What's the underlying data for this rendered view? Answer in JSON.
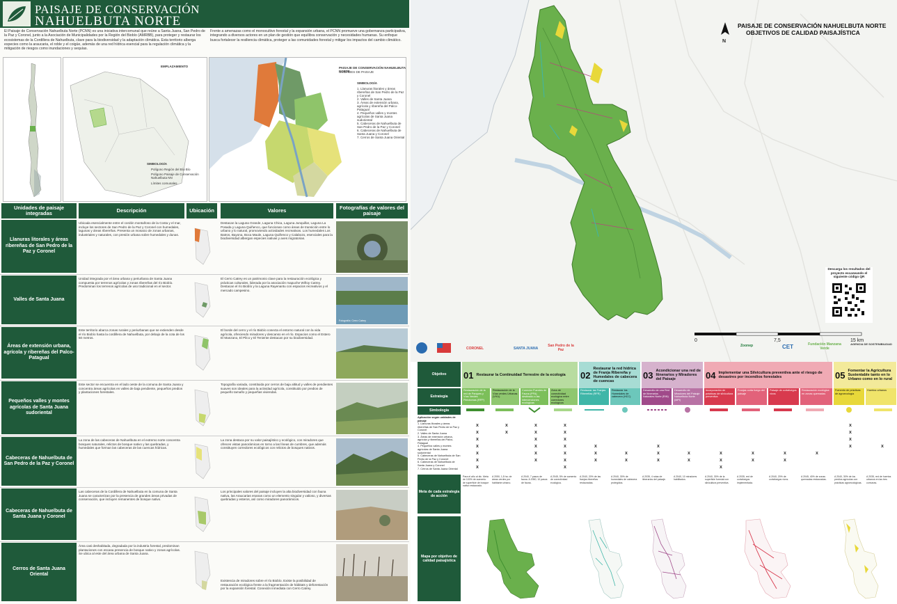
{
  "header": {
    "title_line1": "PAISAJE DE CONSERVACIÓN",
    "title_line2": "NAHUELBUTA NORTE"
  },
  "intro": {
    "col1": "El Paisaje de Conservación Nahuelbuta Norte (PCNN) es una iniciativa intercomunal que reúne a Santa Juana, San Pedro de la Paz y Coronel, junto a la Asociación de Municipalidades por la Región del Biobío (AMRBB), para proteger y restaurar los ecosistemas de la Cordillera de Nahuelbuta, clave para la biodiversidad y la adaptación climática. Esta territorio alberga especies como la araucaria, el roble y el coigüe, además de una red hídrica esencial para la regulación climática y la mitigación de riesgos como inundaciones y sequías.",
    "col2": "Frente a amenazas como el monocultivo forestal y la expansión urbana, el PCNN promueve una gobernanza participativa, integrando a diversos actores en un plan de gestión que equilibra conservación y necesidades humanas. Su enfoque busca fortalecer la resiliencia climática, proteger a las comunidades forestal y mitigar los impactos del cambio climático."
  },
  "inset_maps": {
    "map2_label": "EMPLAZAMIENTO",
    "map3_title": "PAISAJE DE CONSERVACIÓN NAHUELBUTA NORTE",
    "map3_subtitle": "UNIDADES DE PAISAJE",
    "legend_heading": "SIMBOLOGÍA",
    "legend_items": [
      "1. Llanuras litorales y áreas ribereñas de San Pedro de la Paz y Coronel",
      "2. Valles de Santa Juana",
      "3. Áreas de extensión urbana, agrícola y ribereña del Palco-Patagual",
      "4. Pequeños valles y montes agrícolas de Santa Juana sudoriental",
      "5. Cabeceras de Nahuelbuta de San Pedro de la Paz y Coronel",
      "6. Cabeceras de Nahuelbuta de Santa Juana y Coronel",
      "7. Cerros de Santa Juana Oriental"
    ],
    "map2_legend": [
      "SIMBOLOGÍA",
      "Polígono Región del Bío Bío",
      "Polígono Paisaje de Conservación Nahuelbuta NN",
      "Límites comunales"
    ]
  },
  "table": {
    "headers": [
      "Unidades de paisaje integradas",
      "Descripción",
      "Ubicación",
      "Valores",
      "Fotografías de valores del paisaje"
    ],
    "rows": [
      {
        "unit": "Llanuras litorales y áreas ribereñas de San Pedro de la Paz y Coronel",
        "desc": "Ubicada esencialmente entre el cordón montañoso de la Costa y el mar, incluye los sectores de San Pedro de la Paz y Coronel con humedales, lagunas y áreas ribereñas. Presenta un mosaico de zonas urbanas, industriales y naturales, con presión urbana sobre humedales y dunas.",
        "val": "Destacan la Laguna Grande, Laguna Chica, Laguna Junquillar, Laguna La Posada y Laguna Quiñenco, que funcionan como áreas de transición entre lo urbano y lo natural, promoviendo actividades recreativas. Los humedales Los Batros, Bayona, Boca Maule, Laguna Quiñenco y Calabozo, esenciales para la biodiversidad albergan especies nativas y aves migratorias."
      },
      {
        "unit": "Valles de Santa Juana",
        "desc": "Unidad integrada por el área urbana y periurbana de Santa Juana compuesta por terrenos agrícolas y zonas ribereñas del río Biobío. Predominan los terrenos agrícolas de uso tradicional en el sector.",
        "val": "El Cerro Catrey es un patrimonio clave para la restauración ecológica y prácticas culturales, liderada por la asociación mapuche Wiñoy Catrey. Destacan el río Biobío y la Laguna Rayenantu con espacios recreativos y el mercado campesino."
      },
      {
        "unit": "Áreas de extensión urbana, agrícola y ribereñas del Palco-Patagual",
        "desc": "Este territorio abarca zonas rurales y periurbanas que se extienden desde el río Biobío hasta la cordillera de Nahuelbuta, por debajo de la cota de los 50 metros.",
        "val": "El borde del cerro y el río Biobío conecta el entorno natural con la vida agrícola, ofreciendo miradores y descanso en el río. Espacios como el Estero El Manzano, El Pilco y El Teniente destacan por su biodiversidad."
      },
      {
        "unit": "Pequeños valles y montes agrícolas de Santa Juana sudoriental",
        "desc": "Este sector se encuentra en el lado oeste de la comuna de Santa Juana y concentra áreas agrícolas en valles de baja pendiente, pequeños predios y plantaciones forestales.",
        "val": "Topografía variada, constituida por cerros de baja altitud y valles de pendientes suaves son ideales para la actividad agrícola, constituido por predios de pequeño tamaño y pequeñas viviendas."
      },
      {
        "unit": "Cabeceras de Nahuelbuta de San Pedro de la Paz y Coronel",
        "desc": "La zona de las cabeceras de Nahuelbuta en el extremo norte concentra bosques naturales, relictos de bosque nativo y las quebradas, y humedales que forman las cabeceras de las cuencas hídricas.",
        "val": "La zona destaca por su valor paisajístico y ecológico, con miradores que ofrecen vistas panorámicas en torno a las líneas de cumbres, que además constituyen corredores ecológicos con relictos de bosques nativos."
      },
      {
        "unit": "Cabeceras de Nahuelbuta de Santa Juana y Coronel",
        "desc": "Las cabeceras de la Cordillera de Nahuelbuta en la comuna de Santa Juana se caracterizan por la presencia de grandes áreas privadas de conservación, que incluyen remanentes de bosque nativo.",
        "val": "Los principales valores del paisaje incluyen la alta biodiversidad con fauna nativa, las Araucarias enanas como un elemento singular y valioso, y diversas quebradas y esteros, así como miradores panorámicos."
      },
      {
        "unit": "Cerros de Santa Juana Oriental",
        "desc": "Área casi deshabitada, degradada por la industria forestal, predominan plantaciones con escasa presencia de bosque nativo y zonas agrícolas. Se ubica al este del área urbana de Santa Juana.",
        "val": "Existencia de miradores sobre el río Biobío. Existe la posibilidad de restauración ecológica frente a la fragmentación de hábitats y deforestación por la expansión forestal. Conexión inmediata con Cerro Catrey."
      }
    ],
    "photo_caption": "Fotografía: Cerro Catrey"
  },
  "right_title": {
    "line1": "PAISAJE DE CONSERVACIÓN NAHUELBUTA NORTE",
    "line2": "OBJETIVOS DE CALIDAD PAISAJÍSTICA",
    "north": "N"
  },
  "qr": {
    "text": "Descarga los resultados del proyecto escaneando el siguiente código QR"
  },
  "scale": {
    "labels": [
      "0",
      "7,5",
      "15 km"
    ]
  },
  "logos": [
    "CORONEL",
    "SANTA JUANA",
    "San Pedro de la Paz",
    "Zoonep",
    "CET",
    "Fundación Manzana Verde",
    "AGENCIA DE SOSTENIBILIDAD"
  ],
  "matrix": {
    "row_labels": [
      "Objetivo",
      "Estrategia",
      "Simbología",
      "Meta de cada estrategia de acción",
      "Mapa por objetivo de calidad paisajística"
    ],
    "objectives": [
      {
        "num": "01",
        "title": "Restaurar la Continuidad Terrestre de la ecología",
        "color": "#7cbf5a"
      },
      {
        "num": "02",
        "title": "Restaurar la red hídrica de Franja Ribereña y Humedales de cabecera de cuencas",
        "color": "#3fb6a8"
      },
      {
        "num": "03",
        "title": "Acondicionar una red de Itinerarios y Miradores del Paisaje",
        "color": "#a04a8a"
      },
      {
        "num": "04",
        "title": "Implementar una Silvicultura preventiva ante el riesgo de desastres por incendios forestales",
        "color": "#d83a4e"
      },
      {
        "num": "05",
        "title": "Fomentar la Agricultura Sustentable tanto en lo Urbano como en lo rural",
        "color": "#e8d83a"
      }
    ],
    "strategies": [
      "Restauración de la red de Parques y Vías Verdes Pleiotomas (RFP)",
      "Restauración de la Vías verdes Urbanas (VVU)",
      "Corredor Puentes de Fauna (PFA) destinado a las intervenciones ecológicas",
      "Zona de conectividad ecológica entre corredores ecológicos",
      "Restaurar las Franjas Ribereñas (RFR)",
      "Restaurar los Humedales de cabecera (HCC)",
      "Desarrollo de una Red de Itinerarios Naturales Norte (RIN)",
      "Desarrollo de Miradores del Paisaje Nahuelbuta Norte (MPI)",
      "Incorporación de prácticas de silvicultura preventiva",
      "Franjas corta fuego del paisaje",
      "Paisaje de cortafuegos vivos",
      "Restauración ecológica en zonas quemadas",
      "Fomento de prácticas de agroecología",
      "Huertos urbanos"
    ],
    "symbology_header": "Aplicación según unidades de paisaje",
    "symbology_units": [
      "1. Llanuras litorales y áreas ribereñas de San Pedro de la Paz y Coronel",
      "2. Valles de Santa Juana",
      "3. Áreas de extensión urbana, agrícola y ribereñas del Palco-Patagual",
      "4. Pequeños valles y montes agrícolas de Santa Juana sudoriental",
      "5. Cabeceras de Nahuelbuta de San Pedro de la Paz y Coronel",
      "6. Cabeceras de Nahuelbuta de Santa Juana y Coronel",
      "7. Cerros de Santa Juana Oriental"
    ],
    "x_mark": "x",
    "metas": [
      "Para el año al dic. Meta de 100% de aumento de superficie de bosque nativo restaurado.",
      "A 2050, 1,5 ha. de áreas verdes por habitante urbano.",
      "A 2040, 7 pasos de fauna. A 2050, 10 pasos de fauna.",
      "A 2045, 5% de aumento de conectividad ecológica.",
      "A 2040, 20% de las franjas ribereñas restauradas.",
      "A 2040, 30% de humedales de cabecera protegidos.",
      "A 2035, 4 rutas de itinerarios del paisaje.",
      "A 2040, 10 miradores habilitados.",
      "A 2040, 30% de la superficie forestal con silvicultura preventiva.",
      "A 2035, red de cortafuegos implementada.",
      "A 2040, 20% de cortafuegos vivos.",
      "A 2045, 40% de zonas quemadas restauradas.",
      "A 2040, 30% de los predios agrícolas con prácticas agroecológicas.",
      "A 2035, red de huertos urbanos en las tres comunas."
    ]
  },
  "colors": {
    "brand": "#1f5a3a",
    "polygon": "#6ab04c",
    "river": "#c9d8e4"
  }
}
